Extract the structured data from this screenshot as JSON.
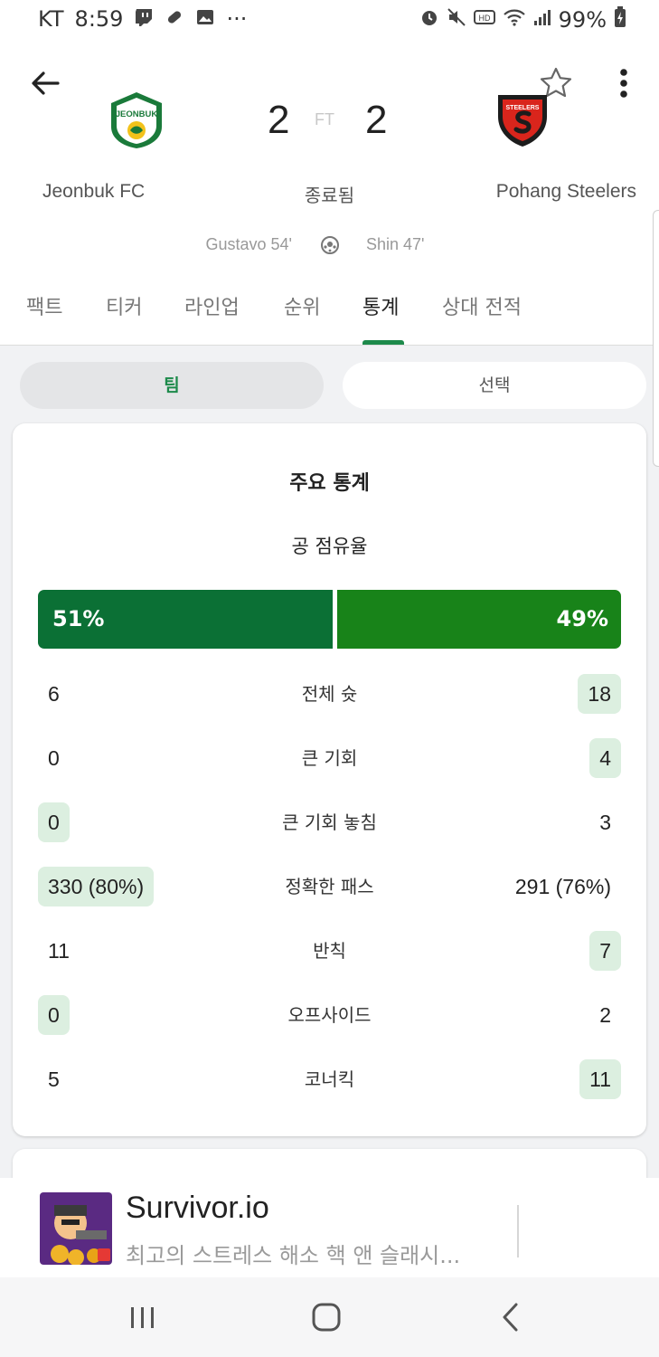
{
  "status_bar": {
    "carrier": "KT",
    "time": "8:59",
    "dots": "···",
    "battery": "99%"
  },
  "match": {
    "home": {
      "name": "Jeonbuk FC",
      "score": "2",
      "crest_text": "JEONBUK"
    },
    "away": {
      "name": "Pohang Steelers",
      "score": "2",
      "crest_text": "STEELERS"
    },
    "separator": "FT",
    "status": "종료됨",
    "scorers": {
      "home": "Gustavo 54'",
      "away": "Shin 47'"
    }
  },
  "tabs": [
    {
      "label": "팩트"
    },
    {
      "label": "티커"
    },
    {
      "label": "라인업"
    },
    {
      "label": "순위"
    },
    {
      "label": "통계"
    },
    {
      "label": "상대 전적"
    }
  ],
  "active_tab": "통계",
  "segments": {
    "team": "팀",
    "player": "선택"
  },
  "stats": {
    "title": "주요 통계",
    "possession": {
      "label": "공 점유율",
      "home": "51%",
      "away": "49%",
      "home_fraction": 0.51
    },
    "rows": [
      {
        "label": "전체 슛",
        "home": "6",
        "away": "18",
        "highlight": "away"
      },
      {
        "label": "큰 기회",
        "home": "0",
        "away": "4",
        "highlight": "away"
      },
      {
        "label": "큰 기회 놓침",
        "home": "0",
        "away": "3",
        "highlight": "home"
      },
      {
        "label": "정확한 패스",
        "home": "330 (80%)",
        "away": "291 (76%)",
        "highlight": "home"
      },
      {
        "label": "반칙",
        "home": "11",
        "away": "7",
        "highlight": "away"
      },
      {
        "label": "오프사이드",
        "home": "0",
        "away": "2",
        "highlight": "home"
      },
      {
        "label": "코너킥",
        "home": "5",
        "away": "11",
        "highlight": "away"
      }
    ]
  },
  "ad": {
    "title": "Survivor.io",
    "description": "최고의 스트레스 해소 핵 앤 슬래시..."
  },
  "colors": {
    "brand_green": "#1d8a4b",
    "home_bar": "#0b7035",
    "away_bar": "#188319",
    "highlight": "#dcefe0"
  }
}
